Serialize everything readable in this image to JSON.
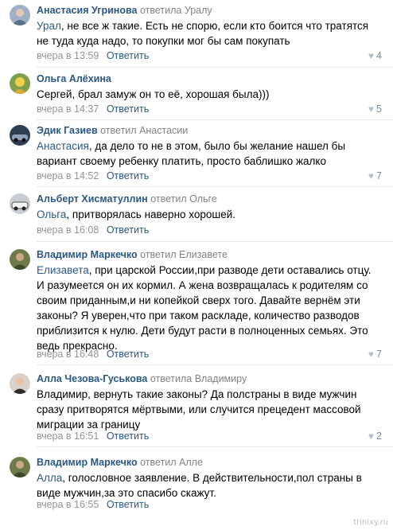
{
  "comments": [
    {
      "author": "Анастасия Угринова",
      "replied_label": "ответила",
      "reply_to": "Уралу",
      "addressee": "Урал",
      "text": ", не все ж такие. Есть не спорю, если кто боится что тратятся не туда куда надо, то покупки мог бы сам покупать",
      "time": "вчера в 13:59",
      "reply_label": "Ответить",
      "likes": "4"
    },
    {
      "author": "Ольга Алёхина",
      "text": "Сергей, брал замуж он то её, хорошая была)))",
      "time": "вчера в 14:37",
      "reply_label": "Ответить",
      "likes": "5"
    },
    {
      "author": "Эдик Газиев",
      "replied_label": "ответил",
      "reply_to": "Анастасии",
      "addressee": "Анастасия",
      "text": ", да дело то не в этом, было бы желание нашел бы вариант своему ребенку платить, просто баблишко жалко",
      "time": "вчера в 14:52",
      "reply_label": "Ответить",
      "likes": "7"
    },
    {
      "author": "Альберт Хисматуллин",
      "replied_label": "ответил",
      "reply_to": "Ольге",
      "addressee": "Ольга",
      "text": ", притворялась наверно хорошей.",
      "time": "вчера в 16:08",
      "reply_label": "Ответить",
      "likes": ""
    },
    {
      "author": "Владимир Маркечко",
      "replied_label": "ответил",
      "reply_to": "Елизавете",
      "addressee": "Елизавета",
      "text": ", при царской России,при разводе дети оставались отцу. И разумеется он их кормил. А жена возвращалась к родителям со своим приданным,и ни копейкой сверх того. Давайте вернём эти законы? Я уверен,что при таком раскладе, количество разводов приблизится к нулю. Дети будут расти в полноценных семьях. Это ведь прекрасно.",
      "time": "вчера в 16:48",
      "reply_label": "Ответить",
      "likes": "7"
    },
    {
      "author": "Алла Чезова-Гуськова",
      "replied_label": "ответила",
      "reply_to": "Владимиру",
      "addressee": "",
      "text": "Владимир, вернуть такие законы? Да полстраны в виде мужчин сразу притворятся мёртвыми, или случится прецедент массовой миграции за границу",
      "time": "вчера в 16:51",
      "reply_label": "Ответить",
      "likes": "2"
    },
    {
      "author": "Владимир Маркечко",
      "replied_label": "ответил",
      "reply_to": "Алле",
      "addressee": "Алла",
      "text": ", голословное заявление. В действительности,пол страны в виде мужчин,за это спасибо скажут.",
      "time": "вчера в 16:55",
      "reply_label": "Ответить",
      "likes": ""
    }
  ],
  "watermark": "trinixy.ru",
  "icons": {
    "like": "heart-icon"
  },
  "colors": {
    "link": "#2a5885",
    "meta": "#939393",
    "separator": "#e7e8ec"
  }
}
